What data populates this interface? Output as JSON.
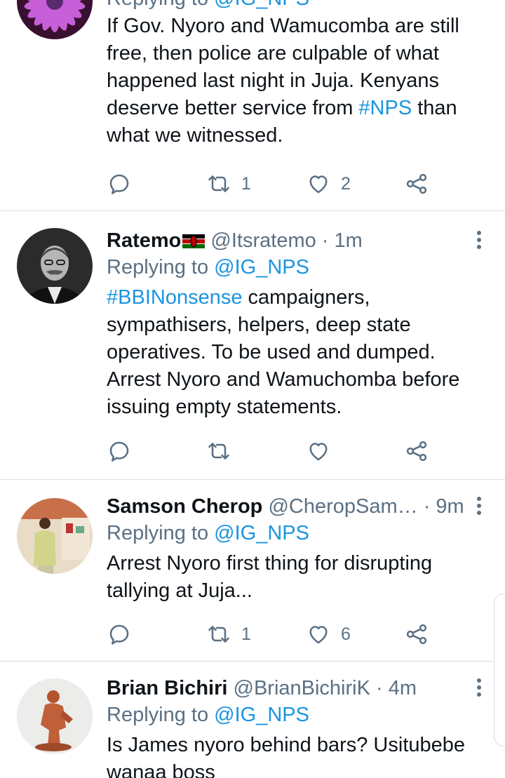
{
  "tweets": [
    {
      "name": "",
      "handle": "",
      "time": "",
      "replying_prefix": "Replying to",
      "replying_to": "@IG_NPS",
      "body": [
        {
          "t": "If Gov. Nyoro and Wamucomba are still free, then police are culpable of what happened last night in Juja. Kenyans deserve better service from "
        },
        {
          "t": "#NPS",
          "tag": true
        },
        {
          "t": " than what we witnessed."
        }
      ],
      "retweets": "1",
      "likes": "2",
      "avatar_icon": "flower-avatar"
    },
    {
      "name": "Ratemo",
      "handle": "@Itsratemo",
      "time": "· 1m",
      "replying_prefix": "Replying to",
      "replying_to": "@IG_NPS",
      "body": [
        {
          "t": "#BBINonsense",
          "tag": true
        },
        {
          "t": " campaigners, sympathisers, helpers, deep state operatives. To be used and dumped. Arrest Nyoro and Wamuchomba before issuing empty statements."
        }
      ],
      "retweets": "",
      "likes": "",
      "avatar_icon": "portrait-avatar"
    },
    {
      "name": "Samson Cherop",
      "handle": "@CheropSam…",
      "time": "· 9m",
      "replying_prefix": "Replying to",
      "replying_to": "@IG_NPS",
      "body": [
        {
          "t": "Arrest Nyoro first thing for disrupting tallying at Juja..."
        }
      ],
      "retweets": "1",
      "likes": "6",
      "avatar_icon": "person-avatar"
    },
    {
      "name": "Brian Bichiri",
      "handle": "@BrianBichiriK",
      "time": "· 4m",
      "replying_prefix": "Replying to",
      "replying_to": "@IG_NPS",
      "body": [
        {
          "t": "Is James nyoro behind bars? Usitubebe wanaa boss"
        }
      ],
      "retweets": "",
      "likes": "",
      "avatar_icon": "sculpture-avatar"
    }
  ],
  "colors": {
    "link": "#1b95e0",
    "secondary": "#5b7083",
    "divider": "#d9dee2",
    "text": "#0f1419"
  },
  "icons": {
    "reply": "reply-icon",
    "retweet": "retweet-icon",
    "like": "heart-icon",
    "share": "share-icon",
    "more": "more-options-icon",
    "flag": "kenya-flag-icon"
  }
}
